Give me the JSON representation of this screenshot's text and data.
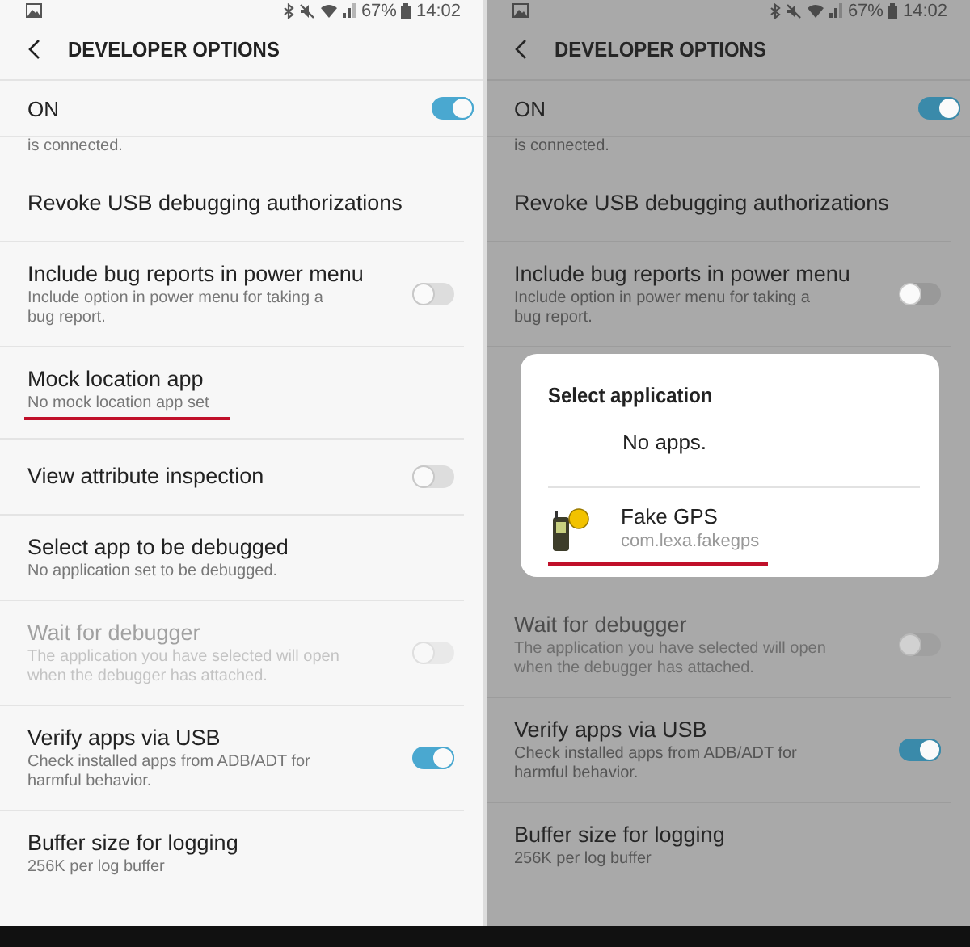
{
  "panels": [
    {
      "dimmed": false,
      "status_bar": {
        "battery": "67%",
        "time": "14:02"
      },
      "title": "DEVELOPER OPTIONS",
      "master": {
        "label": "ON",
        "on": true
      },
      "cut_text": "is connected.",
      "rows": [
        {
          "kind": "plain",
          "title": "Revoke USB debugging authorizations",
          "disabled": false,
          "underlined": false
        },
        {
          "kind": "switch",
          "title": "Include bug reports in power menu",
          "summary": "Include option in power menu for taking a bug report.",
          "on": false,
          "disabled": false,
          "underlined": false
        },
        {
          "kind": "plain",
          "title": "Mock location app",
          "summary": "No mock location app set",
          "disabled": false,
          "underlined": true
        },
        {
          "kind": "switch",
          "title": "View attribute inspection",
          "on": false,
          "disabled": false,
          "underlined": false
        },
        {
          "kind": "plain",
          "title": "Select app to be debugged",
          "summary": "No application set to be debugged.",
          "disabled": false,
          "underlined": false
        },
        {
          "kind": "switch",
          "title": "Wait for debugger",
          "summary": "The application you have selected will open when the debugger has attached.",
          "on": false,
          "disabled": true,
          "underlined": false
        },
        {
          "kind": "switch",
          "title": "Verify apps via USB",
          "summary": "Check installed apps from ADB/ADT for harmful behavior.",
          "on": true,
          "disabled": false,
          "underlined": false
        },
        {
          "kind": "plain",
          "title": "Buffer size for logging",
          "summary": "256K per log buffer",
          "disabled": false,
          "underlined": false
        }
      ]
    },
    {
      "dimmed": true,
      "status_bar": {
        "battery": "67%",
        "time": "14:02"
      },
      "title": "DEVELOPER OPTIONS",
      "master": {
        "label": "ON",
        "on": true
      },
      "cut_text": "is connected.",
      "rows": [
        {
          "kind": "plain",
          "title": "Revoke USB debugging authorizations",
          "disabled": false,
          "underlined": false
        },
        {
          "kind": "switch",
          "title": "Include bug reports in power menu",
          "summary": "Include option in power menu for taking a bug report.",
          "on": false,
          "disabled": false,
          "underlined": false
        },
        {
          "kind": "dialog",
          "dialog": {
            "title": "Select application",
            "empty_text": "No apps.",
            "apps": [
              {
                "name": "Fake GPS",
                "package": "com.lexa.fakegps",
                "underlined": true
              }
            ]
          }
        },
        {
          "kind": "switch",
          "title": "Wait for debugger",
          "summary": "The application you have selected will open when the debugger has attached.",
          "on": false,
          "disabled": true,
          "underlined": false
        },
        {
          "kind": "switch",
          "title": "Verify apps via USB",
          "summary": "Check installed apps from ADB/ADT for harmful behavior.",
          "on": true,
          "disabled": false,
          "underlined": false
        },
        {
          "kind": "plain",
          "title": "Buffer size for logging",
          "summary": "256K per log buffer",
          "disabled": false,
          "underlined": false
        }
      ]
    }
  ]
}
